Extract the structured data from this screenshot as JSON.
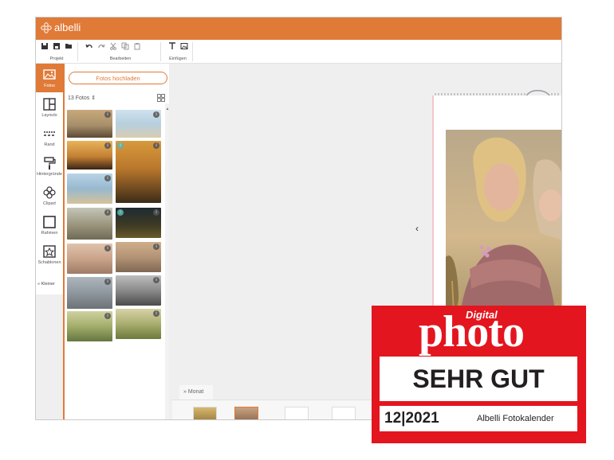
{
  "app": {
    "brand": "albelli"
  },
  "toolbar": {
    "groups": [
      {
        "label": "Projekt",
        "icons": [
          "save-icon",
          "save-as-icon",
          "folder-icon"
        ]
      },
      {
        "label": "Bearbeiten",
        "icons": [
          "undo-icon",
          "redo-icon",
          "cut-icon",
          "copy-icon",
          "paste-icon"
        ]
      },
      {
        "label": "Einfügen",
        "icons": [
          "text-icon",
          "image-icon"
        ]
      }
    ]
  },
  "sidebar": {
    "items": [
      {
        "label": "Fotos",
        "icon": "photos-icon",
        "active": true
      },
      {
        "label": "Layouts",
        "icon": "layouts-icon",
        "active": false
      },
      {
        "label": "Rand",
        "icon": "border-icon",
        "active": false
      },
      {
        "label": "Hintergründe",
        "icon": "paint-roller-icon",
        "active": false
      },
      {
        "label": "Clipart",
        "icon": "clipart-icon",
        "active": false
      },
      {
        "label": "Rahmen",
        "icon": "frame-icon",
        "active": false
      },
      {
        "label": "Schablonen",
        "icon": "template-icon",
        "active": false
      }
    ],
    "collapse_label": "Kleiner"
  },
  "photos_panel": {
    "upload_button": "Fotos hochladen",
    "count_label": "13 Fotos",
    "sort_icon": "sort-icon",
    "grid_icon": "grid-view-icon",
    "badge_text": "i"
  },
  "canvas": {
    "prev_icon": "chevron-left-icon",
    "month_toggle": "Monat"
  },
  "award": {
    "magazine_top": "Digital",
    "magazine_main": "photo",
    "verdict": "SEHR GUT",
    "issue": "12|2021",
    "product": "Albelli Fotokalender"
  },
  "colors": {
    "accent": "#e07a37",
    "seal_red": "#e3151f",
    "canvas_bg": "#efefef",
    "badge_teal": "#5cb5b0"
  }
}
